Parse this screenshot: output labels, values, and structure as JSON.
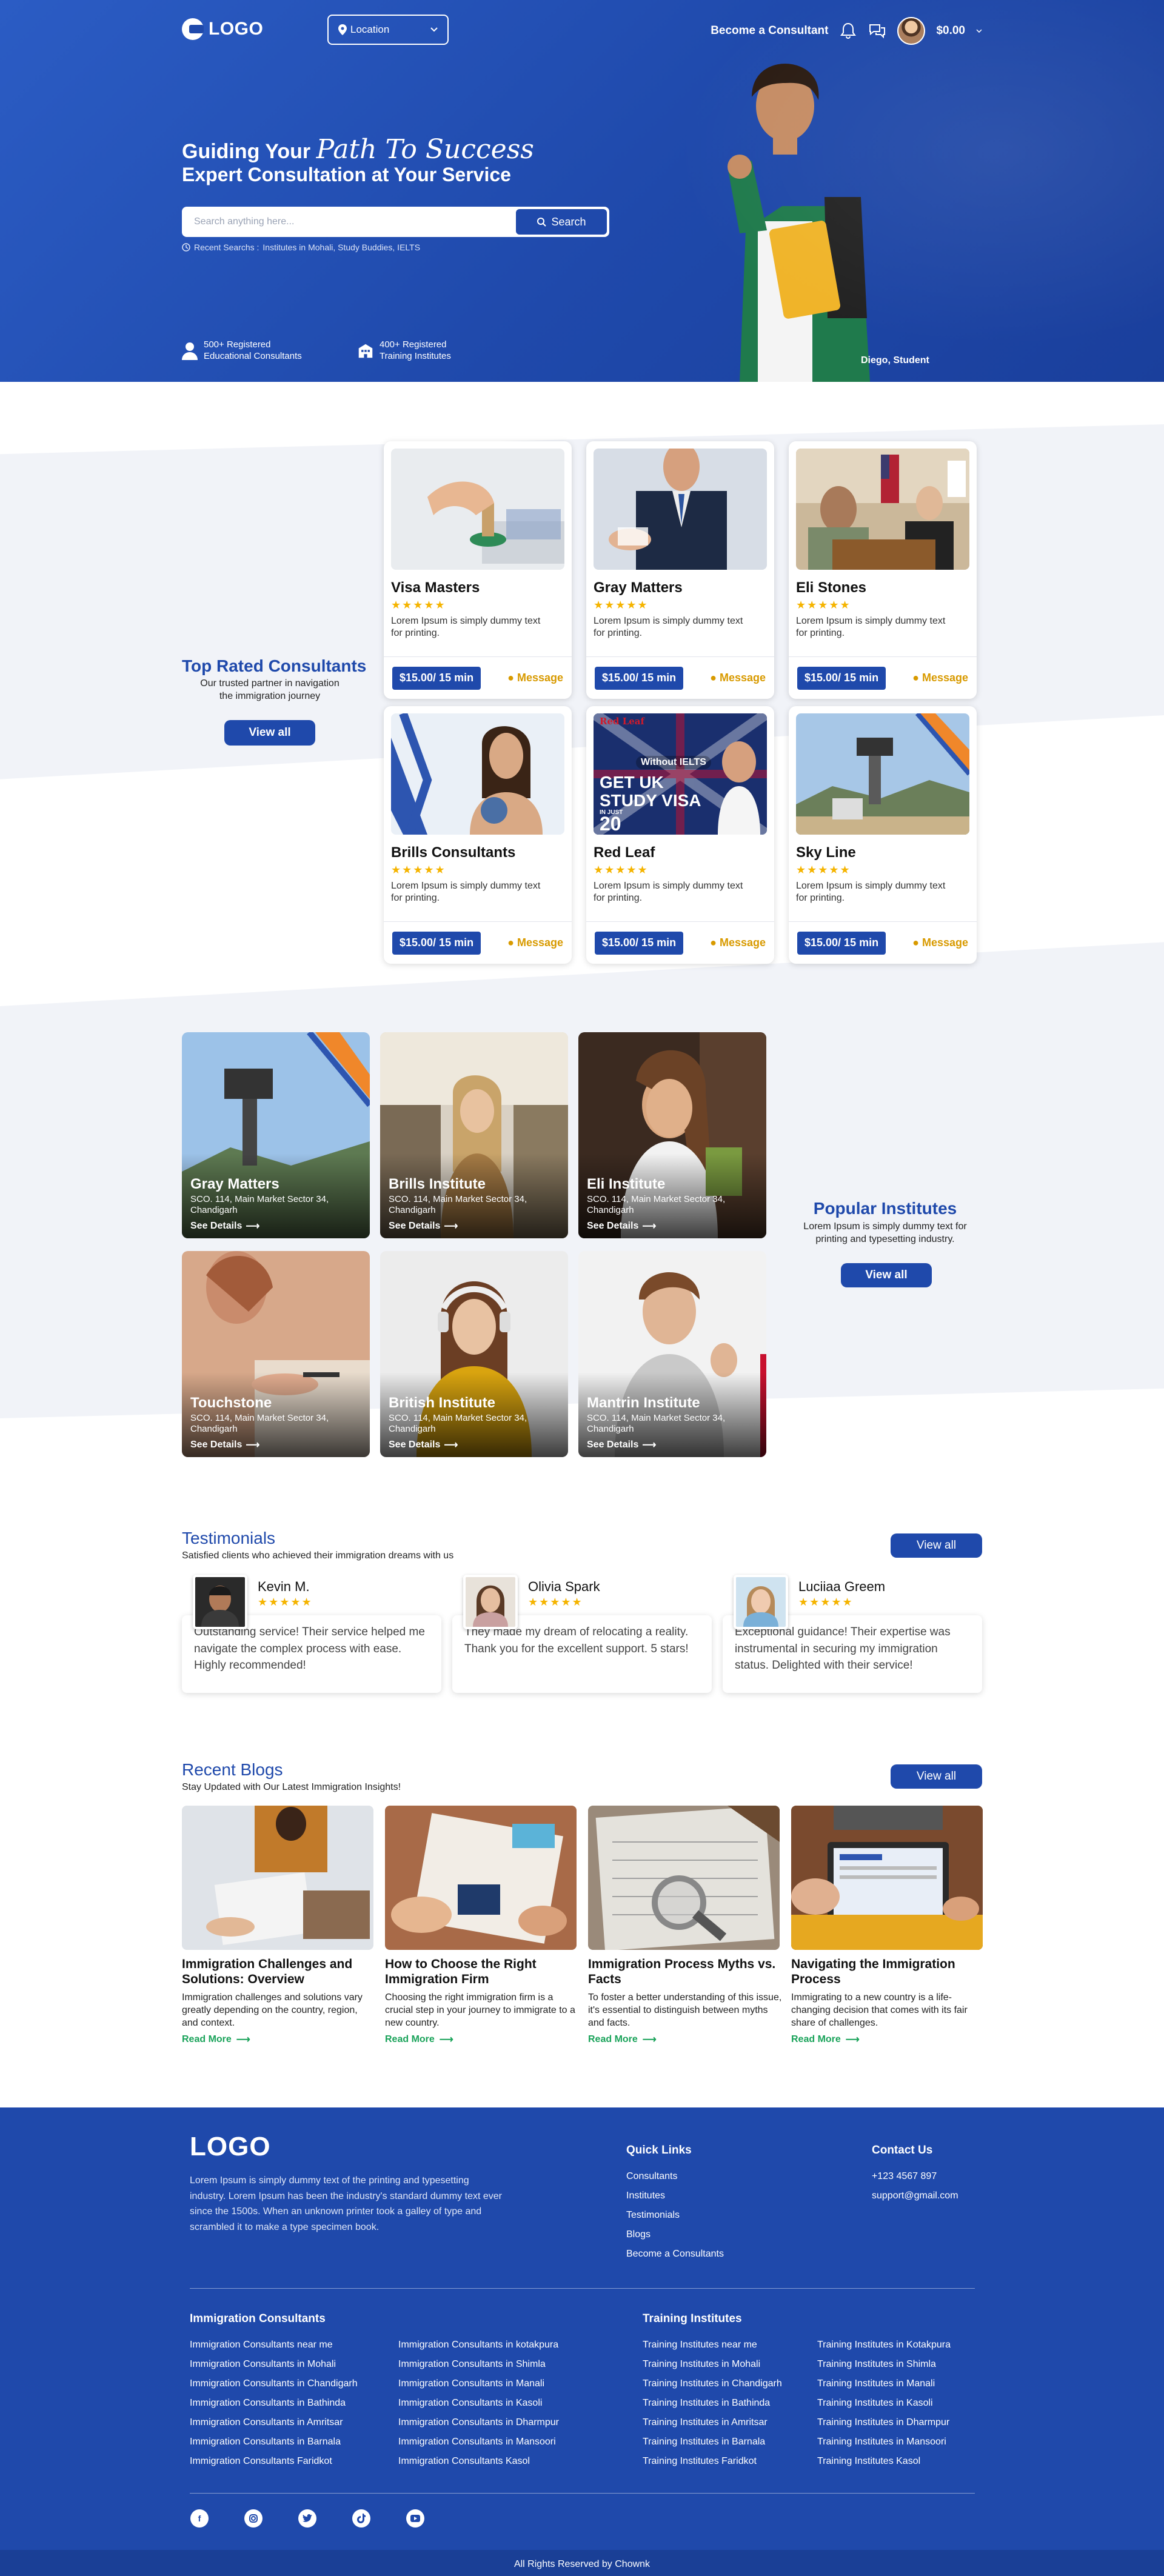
{
  "header": {
    "logo": "LOGO",
    "location_label": "Location",
    "become_consultant": "Become a Consultant",
    "balance": "$0.00"
  },
  "hero": {
    "line1_prefix": "Guiding Your",
    "line1_script": "Path To Success",
    "line2": "Expert Consultation at Your Service",
    "search_placeholder": "Search anything here...",
    "search_button": "Search",
    "recent_label": "Recent Searchs :",
    "recent_items": "Institutes in Mohali, Study Buddies, IELTS",
    "stat1_line1": "500+ Registered",
    "stat1_line2": "Educational Consultants",
    "stat2_line1": "400+ Registered",
    "stat2_line2": "Training Institutes",
    "person_caption": "Diego, Student"
  },
  "consultants": {
    "title": "Top Rated Consultants",
    "subtitle_line1": "Our trusted partner in navigation",
    "subtitle_line2": "the immigration journey",
    "view_all": "View all",
    "cards": [
      {
        "name": "Visa Masters",
        "stars": "★★★★★",
        "desc": "Lorem Ipsum is simply dummy text for printing.",
        "price": "$15.00/ 15 min",
        "message": "Message"
      },
      {
        "name": "Gray Matters",
        "stars": "★★★★★",
        "desc": "Lorem Ipsum is simply dummy text for printing.",
        "price": "$15.00/ 15 min",
        "message": "Message"
      },
      {
        "name": "Eli Stones",
        "stars": "★★★★★",
        "desc": "Lorem Ipsum is simply dummy text for printing.",
        "price": "$15.00/ 15 min",
        "message": "Message"
      },
      {
        "name": "Brills Consultants",
        "stars": "★★★★★",
        "desc": "Lorem Ipsum is simply dummy text for printing.",
        "price": "$15.00/ 15 min",
        "message": "Message"
      },
      {
        "name": "Red Leaf",
        "stars": "★★★★★",
        "desc": "Lorem Ipsum is simply dummy text for printing.",
        "price": "$15.00/ 15 min",
        "message": "Message"
      },
      {
        "name": "Sky Line",
        "stars": "★★★★★",
        "desc": "Lorem Ipsum is simply dummy text for printing.",
        "price": "$15.00/ 15 min",
        "message": "Message"
      }
    ],
    "redleaf_banner": {
      "brand": "Red Leaf",
      "top": "Without IELTS",
      "line1": "GET UK",
      "line2": "STUDY VISA",
      "in_just": "IN JUST",
      "days": "20"
    }
  },
  "institutes": {
    "title": "Popular Institutes",
    "subtitle_line1": "Lorem Ipsum is simply dummy text for",
    "subtitle_line2": "printing and typesetting industry.",
    "view_all": "View all",
    "cards": [
      {
        "name": "Gray Matters",
        "addr": "SCO. 114, Main Market Sector 34, Chandigarh",
        "see": "See Details"
      },
      {
        "name": "Brills Institute",
        "addr": "SCO. 114, Main Market Sector 34, Chandigarh",
        "see": "See Details"
      },
      {
        "name": "Eli Institute",
        "addr": "SCO. 114, Main Market Sector 34, Chandigarh",
        "see": "See Details"
      },
      {
        "name": "Touchstone",
        "addr": "SCO. 114, Main Market Sector 34, Chandigarh",
        "see": "See Details"
      },
      {
        "name": "British Institute",
        "addr": "SCO. 114, Main Market Sector 34, Chandigarh",
        "see": "See Details"
      },
      {
        "name": "Mantrin Institute",
        "addr": "SCO. 114, Main Market Sector 34, Chandigarh",
        "see": "See Details"
      }
    ]
  },
  "testimonials": {
    "title": "Testimonials",
    "subtitle": "Satisfied clients who achieved their immigration dreams with us",
    "view_all": "View all",
    "items": [
      {
        "name": "Kevin M.",
        "stars": "★★★★★",
        "text": "Outstanding service! Their service helped me navigate the complex process with ease. Highly recommended!"
      },
      {
        "name": "Olivia Spark",
        "stars": "★★★★★",
        "text": "They made my dream of relocating a reality. Thank you for the excellent support. 5 stars!"
      },
      {
        "name": "Luciiaa Greem",
        "stars": "★★★★★",
        "text": "Exceptional guidance! Their expertise was instrumental in securing my immigration status. Delighted with their service!"
      }
    ]
  },
  "blogs": {
    "title": "Recent Blogs",
    "subtitle": "Stay Updated with Our Latest Immigration Insights!",
    "view_all": "View all",
    "items": [
      {
        "title": "Immigration Challenges and Solutions: Overview",
        "desc": "Immigration challenges and solutions vary greatly depending on the country, region, and context.",
        "read": "Read More"
      },
      {
        "title": "How to Choose the Right Immigration Firm",
        "desc": "Choosing the right immigration firm is a crucial step in your journey to immigrate to a new country.",
        "read": "Read More"
      },
      {
        "title": "Immigration Process Myths vs. Facts",
        "desc": "To foster a better understanding of this issue, it's essential to distinguish between myths and facts.",
        "read": "Read More"
      },
      {
        "title": "Navigating the Immigration Process",
        "desc": "Immigrating to a new country is a life-changing decision that comes with its fair share of challenges.",
        "read": "Read More"
      }
    ]
  },
  "footer": {
    "logo": "LOGO",
    "about": "Lorem Ipsum is simply dummy text of the printing and typesetting industry. Lorem Ipsum has been the industry's standard dummy text ever since the 1500s. When an unknown printer took a galley of type and scrambled it to make a type specimen book.",
    "quick_links_title": "Quick Links",
    "quick_links": [
      "Consultants",
      "Institutes",
      "Testimonials",
      "Blogs",
      "Become a Consultants"
    ],
    "contact_title": "Contact Us",
    "phone": "+123 4567 897",
    "email": "support@gmail.com",
    "consultants_title": "Immigration Consultants",
    "consultants_col1": [
      "Immigration Consultants near me",
      "Immigration Consultants in Mohali",
      "Immigration Consultants in Chandigarh",
      "Immigration Consultants in Bathinda",
      "Immigration Consultants in Amritsar",
      "Immigration Consultants in Barnala",
      "Immigration Consultants Faridkot"
    ],
    "consultants_col2": [
      "Immigration Consultants in kotakpura",
      "Immigration Consultants in Shimla",
      "Immigration Consultants in Manali",
      "Immigration Consultants in Kasoli",
      "Immigration Consultants in Dharmpur",
      "Immigration Consultants in Mansoori",
      "Immigration Consultants Kasol"
    ],
    "institutes_title": "Training Institutes",
    "institutes_col1": [
      "Training Institutes near me",
      "Training Institutes in Mohali",
      "Training Institutes in Chandigarh",
      "Training Institutes in Bathinda",
      "Training Institutes in Amritsar",
      "Training Institutes in Barnala",
      "Training Institutes Faridkot"
    ],
    "institutes_col2": [
      "Training Institutes in Kotakpura",
      "Training Institutes in Shimla",
      "Training Institutes in Manali",
      "Training Institutes in Kasoli",
      "Training Institutes in Dharmpur",
      "Training Institutes in Mansoori",
      "Training Institutes Kasol"
    ],
    "social_icons": [
      "facebook-icon",
      "instagram-icon",
      "twitter-icon",
      "tiktok-icon",
      "youtube-icon"
    ],
    "copyright": "All Rights Reserved by Chownk"
  },
  "colors": {
    "primary": "#1f49ab",
    "star": "#f5b400",
    "message": "#d89a00",
    "read_more": "#1aa35a",
    "section_bg": "#f1f3f8"
  }
}
